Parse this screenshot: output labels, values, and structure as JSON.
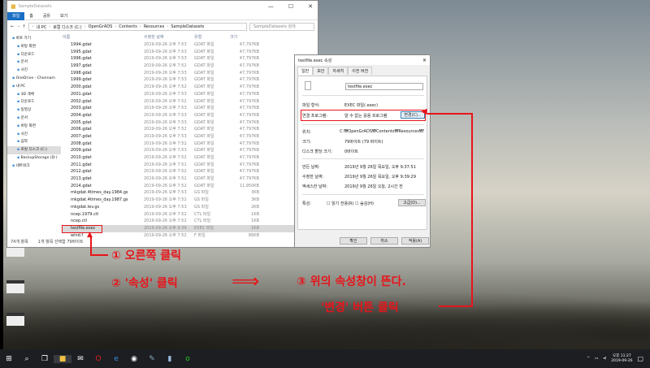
{
  "explorer": {
    "title": "SampleDatasets",
    "ribbon_tabs": [
      "파일",
      "홈",
      "공유",
      "보기"
    ],
    "breadcrumb": [
      "내 PC",
      "로컬 디스크 (C:)",
      "OpenGrADS",
      "Contents",
      "Resources",
      "SampleDatasets"
    ],
    "search_placeholder": "SampleDatasets 검색",
    "nav": [
      {
        "label": "바로 가기",
        "icon": "star-icon"
      },
      {
        "label": "바탕 화면",
        "icon": "desktop-icon"
      },
      {
        "label": "다운로드",
        "icon": "download-icon"
      },
      {
        "label": "문서",
        "icon": "document-icon"
      },
      {
        "label": "사진",
        "icon": "picture-icon"
      },
      {
        "label": "OneDrive - Chonnam",
        "icon": "cloud-icon"
      },
      {
        "label": "내 PC",
        "icon": "computer-icon"
      },
      {
        "label": "3D 개체",
        "icon": "cube-icon"
      },
      {
        "label": "다운로드",
        "icon": "download-icon"
      },
      {
        "label": "동영상",
        "icon": "video-icon"
      },
      {
        "label": "문서",
        "icon": "document-icon"
      },
      {
        "label": "바탕 화면",
        "icon": "desktop-icon"
      },
      {
        "label": "사진",
        "icon": "picture-icon"
      },
      {
        "label": "음악",
        "icon": "music-icon"
      },
      {
        "label": "로컬 디스크 (C:)",
        "icon": "drive-icon",
        "selected": true
      },
      {
        "label": "BackupStorage (D:)",
        "icon": "drive-icon"
      },
      {
        "label": "네트워크",
        "icon": "network-icon"
      }
    ],
    "columns": [
      "이름",
      "수정한 날짜",
      "유형",
      "크기"
    ],
    "files": [
      [
        "1994.gdat",
        "2019-09-26 오후 7:53",
        "GDAT 파일",
        "47,797KB"
      ],
      [
        "1995.gdat",
        "2019-09-26 오후 7:53",
        "GDAT 파일",
        "47,797KB"
      ],
      [
        "1996.gdat",
        "2019-09-26 오후 7:53",
        "GDAT 파일",
        "47,797KB"
      ],
      [
        "1997.gdat",
        "2019-09-26 오후 7:52",
        "GDAT 파일",
        "47,797KB"
      ],
      [
        "1998.gdat",
        "2019-09-26 오후 7:53",
        "GDAT 파일",
        "47,797KB"
      ],
      [
        "1999.gdat",
        "2019-09-26 오후 7:53",
        "GDAT 파일",
        "47,797KB"
      ],
      [
        "2000.gdat",
        "2019-09-26 오후 7:52",
        "GDAT 파일",
        "47,797KB"
      ],
      [
        "2001.gdat",
        "2019-09-26 오후 7:53",
        "GDAT 파일",
        "47,797KB"
      ],
      [
        "2002.gdat",
        "2019-09-26 오후 7:52",
        "GDAT 파일",
        "47,797KB"
      ],
      [
        "2003.gdat",
        "2019-09-26 오후 7:53",
        "GDAT 파일",
        "47,797KB"
      ],
      [
        "2004.gdat",
        "2019-09-26 오후 7:53",
        "GDAT 파일",
        "47,797KB"
      ],
      [
        "2005.gdat",
        "2019-09-26 오후 7:53",
        "GDAT 파일",
        "47,797KB"
      ],
      [
        "2006.gdat",
        "2019-09-26 오후 7:52",
        "GDAT 파일",
        "47,797KB"
      ],
      [
        "2007.gdat",
        "2019-09-26 오후 7:53",
        "GDAT 파일",
        "47,797KB"
      ],
      [
        "2008.gdat",
        "2019-09-26 오후 7:52",
        "GDAT 파일",
        "47,797KB"
      ],
      [
        "2009.gdat",
        "2019-09-26 오후 7:53",
        "GDAT 파일",
        "47,797KB"
      ],
      [
        "2010.gdat",
        "2019-09-26 오후 7:52",
        "GDAT 파일",
        "47,797KB"
      ],
      [
        "2011.gdat",
        "2019-09-26 오후 7:51",
        "GDAT 파일",
        "47,797KB"
      ],
      [
        "2012.gdat",
        "2019-09-26 오후 7:52",
        "GDAT 파일",
        "47,797KB"
      ],
      [
        "2013.gdat",
        "2019-09-26 오후 7:52",
        "GDAT 파일",
        "47,797KB"
      ],
      [
        "2014.gdat",
        "2019-09-26 오후 7:52",
        "GDAT 파일",
        "11,950KB"
      ],
      [
        "mkgdat.4times_day.1984.gs",
        "2019-09-26 오후 7:53",
        "GS 파일",
        "3KB"
      ],
      [
        "mkgdat.4times_day.1987.gs",
        "2019-09-26 오후 7:52",
        "GS 파일",
        "3KB"
      ],
      [
        "mkgdat.lev.gs",
        "2019-09-26 오후 7:53",
        "GS 파일",
        "2KB"
      ],
      [
        "ncep.1979.ctl",
        "2019-09-26 오후 7:52",
        "CTL 파일",
        "1KB"
      ],
      [
        "ncep.ctl",
        "2019-09-26 오후 7:52",
        "CTL 파일",
        "1KB"
      ],
      [
        "testfile.exec",
        "2019-09-26 오후 9:39",
        "EXEC 파일",
        "1KB"
      ],
      [
        "wind.f",
        "2019-09-26 오후 7:52",
        "F 파일",
        "86KB"
      ]
    ],
    "selected_file": "testfile.exec",
    "status_count": "74개 항목",
    "status_selected": "1개 항목 선택함 79바이트"
  },
  "dialog": {
    "title": "testfile.exec 속성",
    "tabs": [
      "일반",
      "보안",
      "자세히",
      "이전 버전"
    ],
    "filename": "testfile.exec",
    "file_type_label": "파일 형식:",
    "file_type": "EXEC 파일(.exec)",
    "opens_with_label": "연결 프로그램:",
    "opens_with": "알 수 없는 응용 프로그램",
    "change_button": "변경(C)...",
    "location_label": "위치:",
    "location": "C:₩OpenGrADS₩Contents₩Resources₩Samp",
    "size_label": "크기:",
    "size": "79바이트 (79 바이트)",
    "disk_size_label": "디스크 할당 크기:",
    "disk_size": "0바이트",
    "created_label": "만든 날짜:",
    "created": "2019년 9월 26일 목요일, 오후 9:37:51",
    "modified_label": "수정한 날짜:",
    "modified": "2019년 9월 26일 목요일, 오후 9:39:29",
    "accessed_label": "액세스한 날짜:",
    "accessed": "2019년 9월 26일 오늘, 2시간 전",
    "attributes_label": "특성:",
    "readonly": "읽기 전용(R)",
    "hidden": "숨김(H)",
    "advanced_button": "고급(D)...",
    "ok": "확인",
    "cancel": "취소",
    "apply": "적용(A)"
  },
  "annotations": {
    "step1": "① 오른쪽 클릭",
    "step2": "② '속성' 클릭",
    "step3": "③ 위의 속성창이 뜬다.",
    "step4": "'변경' 버튼 클릭",
    "color": "#e8141a"
  },
  "taskbar": {
    "time": "오후 11:27",
    "date": "2019-09-26"
  }
}
